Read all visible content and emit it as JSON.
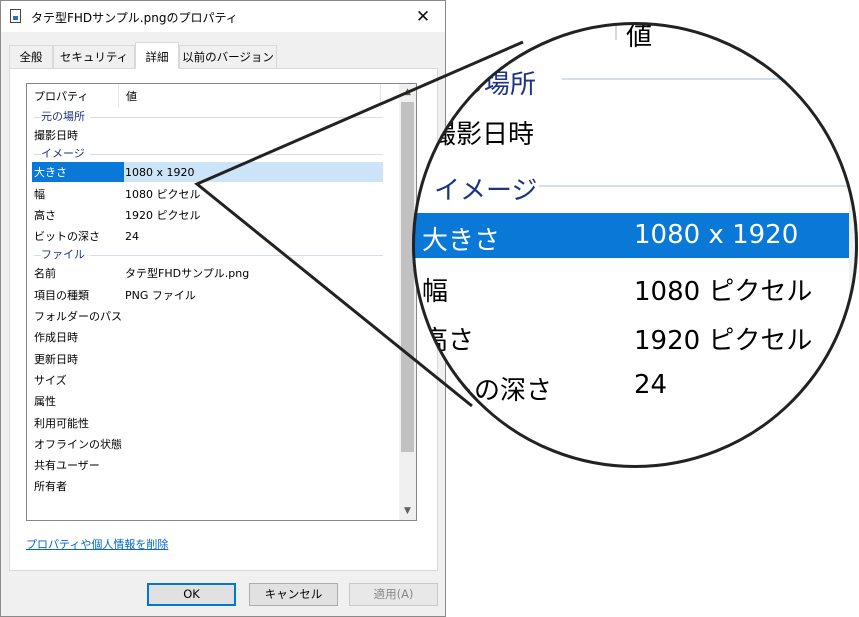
{
  "window": {
    "title": "タテ型FHDサンプル.pngのプロパティ",
    "close_glyph": "✕"
  },
  "tabs": [
    {
      "label": "全般",
      "active": false
    },
    {
      "label": "セキュリティ",
      "active": false
    },
    {
      "label": "詳細",
      "active": true
    },
    {
      "label": "以前のバージョン",
      "active": false
    }
  ],
  "listview": {
    "headers": {
      "property": "プロパティ",
      "value": "値"
    },
    "rows": [
      {
        "type": "group",
        "label": "元の場所"
      },
      {
        "type": "item",
        "key": "撮影日時",
        "value": ""
      },
      {
        "type": "group",
        "label": "イメージ"
      },
      {
        "type": "item",
        "key": "大きさ",
        "value": "1080 x 1920",
        "selected": true
      },
      {
        "type": "item",
        "key": "幅",
        "value": "1080 ピクセル"
      },
      {
        "type": "item",
        "key": "高さ",
        "value": "1920 ピクセル"
      },
      {
        "type": "item",
        "key": "ビットの深さ",
        "value": "24"
      },
      {
        "type": "group",
        "label": "ファイル"
      },
      {
        "type": "item",
        "key": "名前",
        "value": "タテ型FHDサンプル.png"
      },
      {
        "type": "item",
        "key": "項目の種類",
        "value": "PNG ファイル"
      },
      {
        "type": "item",
        "key": "フォルダーのパス",
        "value": ""
      },
      {
        "type": "item",
        "key": "作成日時",
        "value": ""
      },
      {
        "type": "item",
        "key": "更新日時",
        "value": ""
      },
      {
        "type": "item",
        "key": "サイズ",
        "value": ""
      },
      {
        "type": "item",
        "key": "属性",
        "value": ""
      },
      {
        "type": "item",
        "key": "利用可能性",
        "value": ""
      },
      {
        "type": "item",
        "key": "オフラインの状態",
        "value": ""
      },
      {
        "type": "item",
        "key": "共有ユーザー",
        "value": ""
      },
      {
        "type": "item",
        "key": "所有者",
        "value": ""
      }
    ],
    "scroll_up_glyph": "▲",
    "scroll_down_glyph": "▼"
  },
  "remove_link": "プロパティや個人情報を削除",
  "buttons": {
    "ok": "OK",
    "cancel": "キャンセル",
    "apply": "適用(A)"
  },
  "magnifier": {
    "top_partial": "値",
    "group_partial": "の場所",
    "item_partial": "撮影日時",
    "group_image": "イメージ",
    "selected_key": "大きさ",
    "selected_value": "1080 x 1920",
    "width_key": "幅",
    "width_value": "1080 ピクセル",
    "height_key": "高さ",
    "height_value": "1920 ピクセル",
    "depth_key": "ットの深さ",
    "depth_value": "24"
  },
  "colors": {
    "selection": "#0a78d7",
    "selection_light": "#cce4f7",
    "group_text": "#1e3287",
    "link": "#0066cc",
    "ok_border": "#0078d7"
  }
}
